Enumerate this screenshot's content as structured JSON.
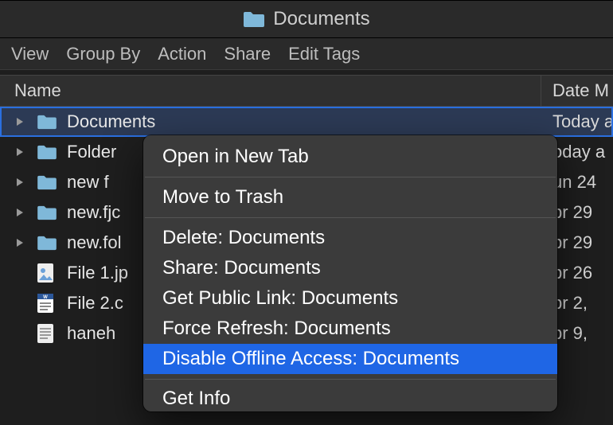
{
  "window": {
    "title": "Documents"
  },
  "toolbar": {
    "view": "View",
    "groupby": "Group By",
    "action": "Action",
    "share": "Share",
    "edittags": "Edit Tags"
  },
  "columns": {
    "name": "Name",
    "date": "Date M"
  },
  "rows": [
    {
      "type": "folder",
      "name": "Documents",
      "date": "Today a",
      "selected": true
    },
    {
      "type": "folder",
      "name": "Folder",
      "date": "oday a"
    },
    {
      "type": "folder",
      "name": "new f",
      "date": "un 24"
    },
    {
      "type": "folder",
      "name": "new.fjc",
      "date": "pr 29"
    },
    {
      "type": "folder",
      "name": "new.fol",
      "date": "pr 29"
    },
    {
      "type": "jpg",
      "name": "File 1.jp",
      "date": "pr 26"
    },
    {
      "type": "doc",
      "name": "File 2.c",
      "date": "pr 2,"
    },
    {
      "type": "txt",
      "name": "haneh",
      "date": "pr 9,"
    }
  ],
  "contextmenu": {
    "open_new_tab": "Open in New Tab",
    "move_trash": "Move to Trash",
    "delete": "Delete: Documents",
    "share": "Share: Documents",
    "publiclink": "Get Public Link: Documents",
    "refresh": "Force Refresh: Documents",
    "offline": "Disable Offline Access: Documents",
    "getinfo": "Get Info"
  }
}
